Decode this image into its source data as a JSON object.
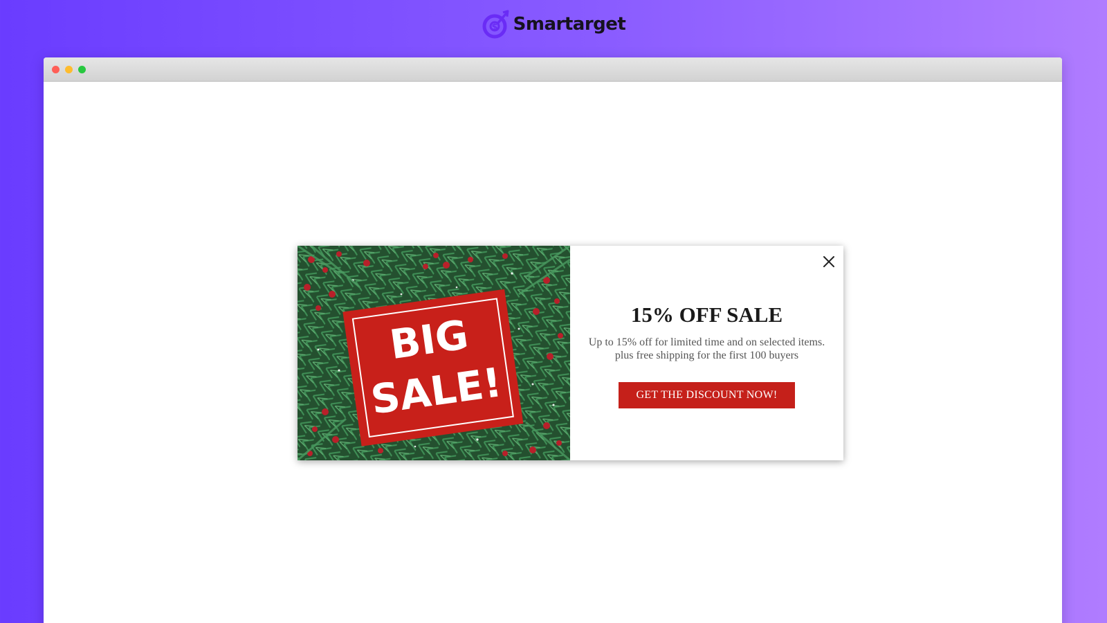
{
  "brand": {
    "name": "Smartarget",
    "icon": "target-logo-icon",
    "accent": "#6a2cf5"
  },
  "browser": {
    "controls": [
      "close-dot",
      "minimize-dot",
      "maximize-dot"
    ],
    "colors": [
      "#ff5f57",
      "#febc2e",
      "#28c840"
    ]
  },
  "popup": {
    "image": {
      "line1": "BIG",
      "line2": "SALE!",
      "background": "pine-branches-with-red-berries",
      "sign_color": "#c8201a"
    },
    "close_icon": "close-icon",
    "heading": "15% OFF SALE",
    "description_line1": "Up to 15% off for limited time and on selected items.",
    "description_line2": "plus free shipping for the first 100 buyers",
    "cta_label": "GET THE DISCOUNT NOW!",
    "cta_color": "#c5201a"
  }
}
